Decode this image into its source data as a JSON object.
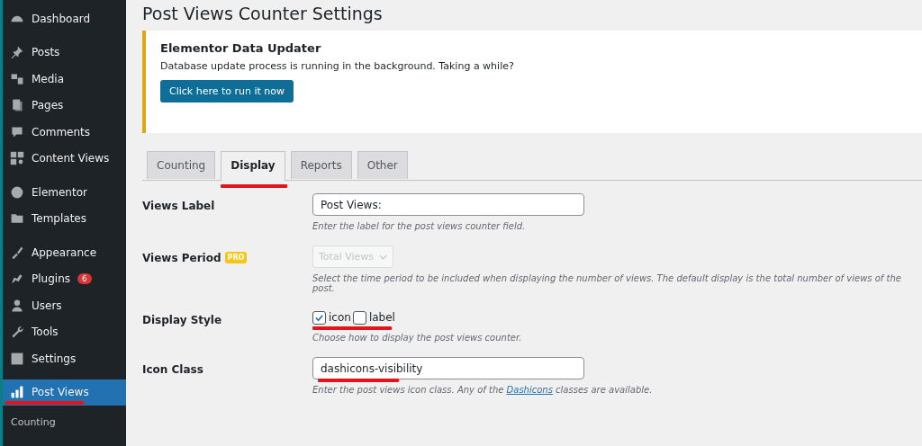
{
  "page_title": "Post Views Counter Settings",
  "sidebar": {
    "groups": [
      [
        {
          "label": "Dashboard",
          "selected": false
        }
      ],
      [
        {
          "label": "Posts",
          "selected": false
        },
        {
          "label": "Media",
          "selected": false
        },
        {
          "label": "Pages",
          "selected": false
        },
        {
          "label": "Comments",
          "selected": false
        },
        {
          "label": "Content Views",
          "selected": false
        }
      ],
      [
        {
          "label": "Elementor",
          "selected": false
        },
        {
          "label": "Templates",
          "selected": false
        }
      ],
      [
        {
          "label": "Appearance",
          "selected": false
        },
        {
          "label": "Plugins",
          "selected": false,
          "badge": "6"
        },
        {
          "label": "Users",
          "selected": false
        },
        {
          "label": "Tools",
          "selected": false
        },
        {
          "label": "Settings",
          "selected": false
        }
      ],
      [
        {
          "label": "Post Views",
          "selected": true
        }
      ]
    ],
    "submenu": [
      {
        "label": "Counting"
      }
    ]
  },
  "notice": {
    "title": "Elementor Data Updater",
    "message": "Database update process is running in the background. Taking a while?",
    "button": "Click here to run it now"
  },
  "tabs": [
    {
      "label": "Counting",
      "selected": false
    },
    {
      "label": "Display",
      "selected": true
    },
    {
      "label": "Reports",
      "selected": false
    },
    {
      "label": "Other",
      "selected": false
    }
  ],
  "fields": [
    {
      "kind": "text",
      "label": "Views Label",
      "value": "Post Views:",
      "description": "Enter the label for the post views counter field."
    },
    {
      "kind": "select",
      "label": "Views Period",
      "badge": "PRO",
      "value": "Total Views",
      "disabled": true,
      "description": "Select the time period to be included when displaying the number of views. The default display is the total number of views of the post."
    },
    {
      "kind": "checkboxes",
      "label": "Display Style",
      "options": [
        {
          "label": "icon",
          "checked": true
        },
        {
          "label": "label",
          "checked": false
        }
      ],
      "description": "Choose how to display the post views counter."
    },
    {
      "kind": "text",
      "label": "Icon Class",
      "value": "dashicons-visibility",
      "description_before": "Enter the post views icon class. Any of the ",
      "link": "Dashicons",
      "description_after": " classes are available."
    }
  ]
}
